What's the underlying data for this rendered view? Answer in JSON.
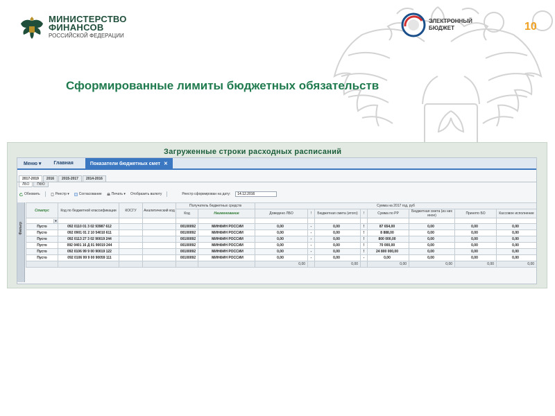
{
  "header": {
    "ministry_line1": "МИНИСТЕРСТВО",
    "ministry_line2": "ФИНАНСОВ",
    "ministry_line3": "РОССИЙСКОЙ ФЕДЕРАЦИИ",
    "eb_line1": "ЭЛЕКТРОННЫЙ",
    "eb_line2": "БЮДЖЕТ",
    "slide_number": "10"
  },
  "title": "Сформированные лимиты бюджетных обязательств",
  "panel_title": "Загруженные строки расходных расписаний",
  "menubar": {
    "menu_label": "Меню ▾",
    "home_label": "Главная",
    "active_tab_label": "Показатели бюджетных смет",
    "active_tab_close": "✕"
  },
  "period_tabs": [
    "2017-2019",
    "2016",
    "2015-2017",
    "2014-2016"
  ],
  "sub_tabs": [
    "ЛБО",
    "ПФО"
  ],
  "toolbar": {
    "refresh": "Обновить",
    "registry": "Реестр ▾",
    "approval": "Согласование",
    "print": "Печать ▾",
    "currency": "Отобразить валюту",
    "date_label": "Реестр сформирован на дату:",
    "date_value": "14.12.2016"
  },
  "filter_strip_label": "Фильтр",
  "columns": {
    "status": "Статус",
    "kbk": "Код по бюджетной классификации",
    "kosgu": "КОСГУ",
    "analytic": "Аналитический код",
    "recipient": "Получатель бюджетных средств",
    "recipient_code": "Код",
    "recipient_name": "Наименование",
    "sum_group": "Сумма на 2017 год, руб",
    "lbo": "Доведено ЛБО",
    "flag1": "!",
    "estimate": "Бюджетная смета (итого)",
    "flag2": "!",
    "sum_rr": "Сумма по РР",
    "estimate_other": "Бюджетная смета (из них иное)",
    "accepted_bo": "Принято БО",
    "cash": "Кассовое исполнение"
  },
  "rows": [
    {
      "status": "Пусто",
      "kbk": "092 0110 01 3 02 93987 612",
      "code": "00100092",
      "name": "МИНФИН РОССИИ",
      "lbo": "0,00",
      "f1": "-",
      "estimate": "0,00",
      "f2": "!",
      "sum_rr": "87 654,00",
      "estimate_other": "0,00",
      "accepted_bo": "0,00",
      "cash": "0,00"
    },
    {
      "status": "Пусто",
      "kbk": "092 0901 01 2 10 54010 611",
      "code": "00100092",
      "name": "МИНФИН РОССИИ",
      "lbo": "0,00",
      "f1": "-",
      "estimate": "0,00",
      "f2": "!",
      "sum_rr": "8 888,00",
      "estimate_other": "0,00",
      "accepted_bo": "0,00",
      "cash": "0,00"
    },
    {
      "status": "Пусто",
      "kbk": "092 0113 27 3 02 90019 244",
      "code": "00100092",
      "name": "МИНФИН РОССИИ",
      "lbo": "0,00",
      "f1": "-",
      "estimate": "0,00",
      "f2": "!",
      "sum_rr": "800 000,00",
      "estimate_other": "0,00",
      "accepted_bo": "0,00",
      "cash": "0,00"
    },
    {
      "status": "Пусто",
      "kbk": "092 0401 16 Д 01 90019 244",
      "code": "00100092",
      "name": "МИНФИН РОССИИ",
      "lbo": "0,00",
      "f1": "-",
      "estimate": "0,00",
      "f2": "!",
      "sum_rr": "70 000,00",
      "estimate_other": "0,00",
      "accepted_bo": "0,00",
      "cash": "0,00"
    },
    {
      "status": "Пусто",
      "kbk": "092 0106 99 9 00 90019 122",
      "code": "00100092",
      "name": "МИНФИН РОССИИ",
      "lbo": "0,00",
      "f1": "-",
      "estimate": "0,00",
      "f2": "!",
      "sum_rr": "24 800 000,00",
      "estimate_other": "0,00",
      "accepted_bo": "0,00",
      "cash": "0,00"
    },
    {
      "status": "Пусто",
      "kbk": "092 0106 99 9 00 90059 111",
      "code": "00100092",
      "name": "МИНФИН РОССИИ",
      "lbo": "0,00",
      "f1": "-",
      "estimate": "0,00",
      "f2": "-",
      "sum_rr": "0,00",
      "estimate_other": "0,00",
      "accepted_bo": "0,00",
      "cash": "0,00"
    }
  ],
  "totals": {
    "lbo": "0,00",
    "estimate": "0,00",
    "sum_rr": "0,00",
    "estimate_other": "0,00",
    "accepted_bo": "0,00",
    "cash": "0,00"
  },
  "colors": {
    "title_green": "#1f7a4d",
    "tab_blue": "#3c78c2",
    "slide_number": "#f0a020",
    "flag_red": "#cc2222"
  }
}
